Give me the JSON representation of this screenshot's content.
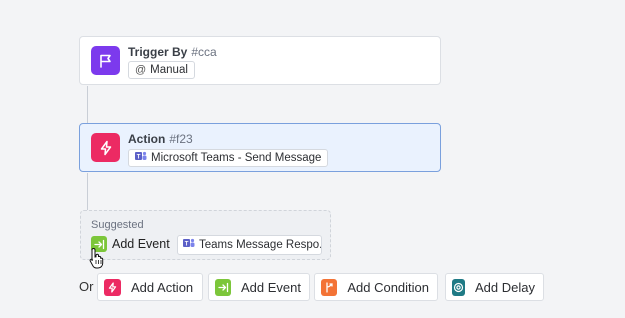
{
  "trigger": {
    "title": "Trigger By",
    "id": "#cca",
    "chip_label": "Manual",
    "icon": "flag-icon",
    "color": "#7c3aed"
  },
  "action": {
    "title": "Action",
    "id": "#f23",
    "chip_label": "Microsoft Teams - Send Message",
    "icon": "bolt-icon",
    "color": "#ec2a63"
  },
  "suggested": {
    "label": "Suggested",
    "event_label": "Add Event",
    "chip_label": "Teams Message Respo...",
    "event_color": "#7cc63a"
  },
  "add_row": {
    "or_label": "Or",
    "buttons": [
      {
        "label": "Add Action",
        "icon": "bolt-icon",
        "color": "#ec2a63"
      },
      {
        "label": "Add Event",
        "icon": "event-icon",
        "color": "#7cc63a"
      },
      {
        "label": "Add Condition",
        "icon": "branch-icon",
        "color": "#f37336"
      },
      {
        "label": "Add Delay",
        "icon": "delay-icon",
        "color": "#1f7a85"
      }
    ]
  }
}
